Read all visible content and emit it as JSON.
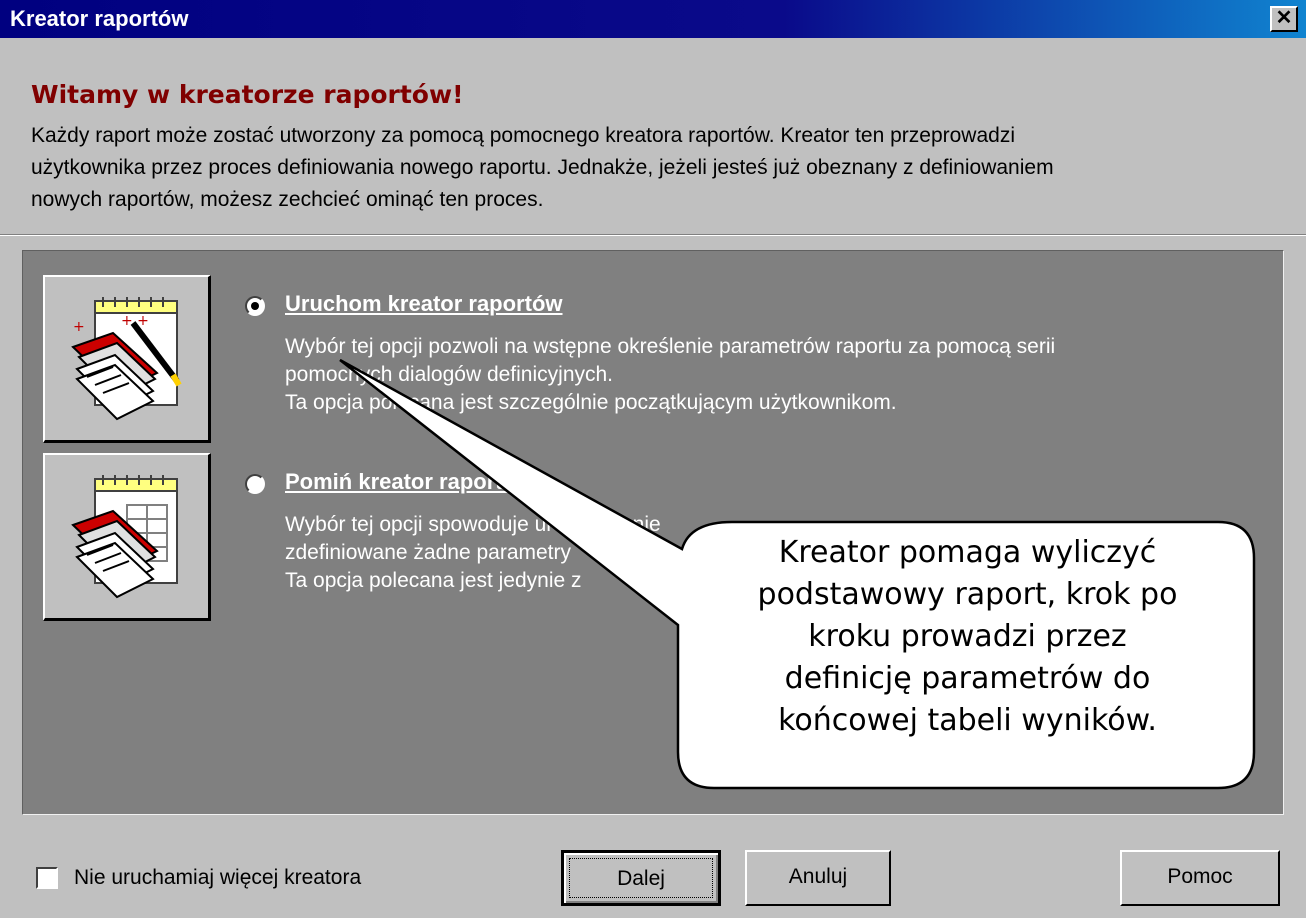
{
  "window": {
    "title": "Kreator raportów",
    "close_glyph": "✕"
  },
  "header": {
    "heading": "Witamy w kreatorze raportów!",
    "intro_lines": [
      "Każdy raport może zostać utworzony za pomocą pomocnego kreatora raportów. Kreator ten przeprowadzi",
      "użytkownika przez proces definiowania nowego raportu. Jednakże, jeżeli jesteś już obeznany z definiowaniem",
      "nowych raportów, możesz zechcieć ominąć ten proces."
    ]
  },
  "options": [
    {
      "label": "Uruchom kreator raportów",
      "selected": true,
      "icon": "report-wizard-icon",
      "description": [
        "Wybór tej opcji pozwoli na wstępne określenie parametrów raportu za pomocą serii",
        "pomocnych dialogów definicyjnych.",
        "Ta opcja polecana jest szczególnie początkującym użytkownikom."
      ]
    },
    {
      "label": "Pomiń kreator raportów",
      "selected": false,
      "icon": "skip-wizard-icon",
      "description": [
        "Wybór tej opcji spowoduje uruchomienie",
        "zdefiniowane żadne parametry",
        "Ta opcja polecana jest jedynie z"
      ]
    }
  ],
  "callout": {
    "lines": [
      "Kreator pomaga wyliczyć",
      "podstawowy raport, krok po",
      "kroku prowadzi przez",
      "definicję parametrów do",
      "końcowej tabeli wyników."
    ]
  },
  "footer": {
    "checkbox_label": "Nie uruchamiaj więcej kreatora",
    "checkbox_checked": false,
    "next_button": "Dalej",
    "cancel_button": "Anuluj",
    "help_button": "Pomoc"
  },
  "colors": {
    "title_bar": "#000080",
    "heading": "#800000",
    "panel": "#808080",
    "dialog": "#c0c0c0"
  }
}
